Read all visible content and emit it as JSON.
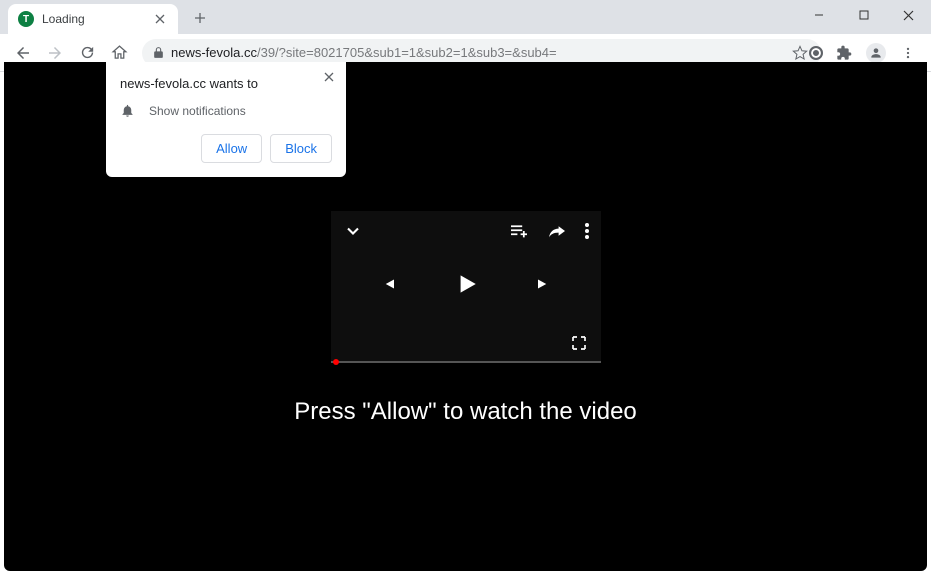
{
  "tab": {
    "title": "Loading",
    "favicon_letter": "T"
  },
  "url": {
    "domain": "news-fevola.cc",
    "path": "/39/?site=8021705&sub1=1&sub2=1&sub3=&sub4="
  },
  "permission": {
    "title": "news-fevola.cc wants to",
    "item": "Show notifications",
    "allow": "Allow",
    "block": "Block"
  },
  "caption": "Press \"Allow\" to watch the video"
}
